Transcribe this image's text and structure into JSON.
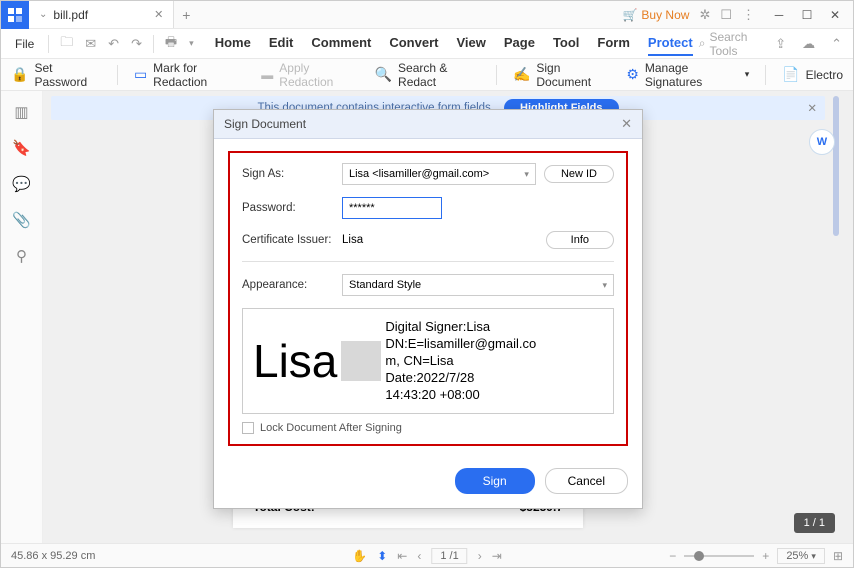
{
  "tab": {
    "name": "bill.pdf"
  },
  "titleRight": {
    "buyNow": "Buy Now"
  },
  "menu": {
    "file": "File",
    "tabs": [
      "Home",
      "Edit",
      "Comment",
      "Convert",
      "View",
      "Page",
      "Tool",
      "Form",
      "Protect"
    ],
    "search": "Search Tools"
  },
  "ribbon": {
    "setPassword": "Set Password",
    "markRedaction": "Mark for Redaction",
    "applyRedaction": "Apply Redaction",
    "searchRedact": "Search & Redact",
    "signDocument": "Sign Document",
    "manageSignatures": "Manage Signatures",
    "electro": "Electro"
  },
  "banner": {
    "text": "This document contains interactive form fields.",
    "button": "Highlight Fields"
  },
  "dialog": {
    "title": "Sign Document",
    "signAsLabel": "Sign As:",
    "signAsValue": "Lisa <lisamiller@gmail.com>",
    "newId": "New ID",
    "passwordLabel": "Password:",
    "passwordValue": "******",
    "issuerLabel": "Certificate Issuer:",
    "issuerValue": "Lisa",
    "info": "Info",
    "appearanceLabel": "Appearance:",
    "appearanceValue": "Standard Style",
    "previewName": "Lisa",
    "previewLine1": "Digital Signer:Lisa",
    "previewLine2": "DN:E=lisamiller@gmail.co",
    "previewLine3": "m, CN=Lisa",
    "previewLine4": "Date:2022/7/28",
    "previewLine5": " 14:43:20 +08:00",
    "lockLabel": "Lock Document After Signing",
    "sign": "Sign",
    "cancel": "Cancel"
  },
  "doc": {
    "dashes": "- - - - - - - - - - - - - - - - - - - - - - - -",
    "totalLabel": "Total Cost:",
    "totalValue": "$5259.7"
  },
  "pageCounter": "1 / 1",
  "status": {
    "size": "45.86 x 95.29 cm",
    "page": "1",
    "pageTotal": "/1",
    "zoom": "25%"
  }
}
